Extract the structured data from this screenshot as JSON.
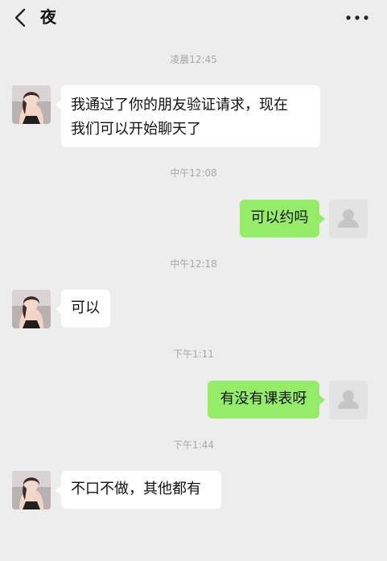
{
  "header": {
    "title": "夜"
  },
  "colors": {
    "background": "#ededed",
    "bubble_in": "#ffffff",
    "bubble_out": "#95ec69",
    "timestamp": "#a8a8a8"
  },
  "icons": {
    "back": "chevron-left-icon",
    "more": "more-dots-icon",
    "contact_avatar": "photo-avatar",
    "self_avatar": "default-user-icon"
  },
  "messages": [
    {
      "timestamp": "凌晨12:45",
      "side": "in",
      "line1": "我通过了你的朋友验证请求，现在",
      "line2": "我们可以开始聊天了"
    },
    {
      "timestamp": "中午12:08",
      "side": "out",
      "text": "可以约吗"
    },
    {
      "timestamp": "中午12:18",
      "side": "in",
      "text": "可以"
    },
    {
      "timestamp": "下午1:11",
      "side": "out",
      "text": "有没有课表呀"
    },
    {
      "timestamp": "下午1:44",
      "side": "in",
      "text": "不口不做，其他都有"
    }
  ]
}
